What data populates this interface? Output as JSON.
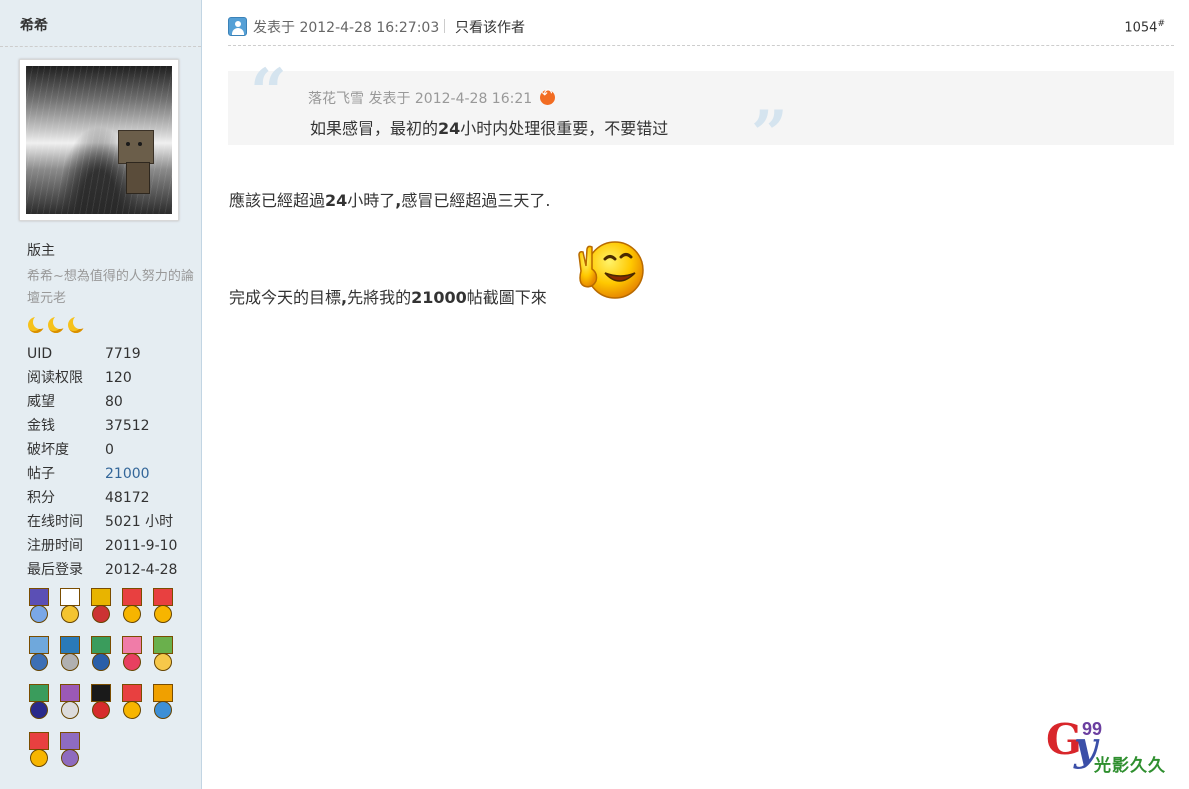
{
  "author": {
    "name": "希希",
    "rank": "版主",
    "title": "希希~想為值得的人努力的論壇元老",
    "star_icons": [
      "moon-icon",
      "moon-icon",
      "moon-icon"
    ]
  },
  "stats": [
    {
      "label": "UID",
      "value": "7719"
    },
    {
      "label": "阅读权限",
      "value": "120"
    },
    {
      "label": "威望",
      "value": "80"
    },
    {
      "label": "金钱",
      "value": "37512"
    },
    {
      "label": "破坏度",
      "value": "0"
    },
    {
      "label": "帖子",
      "value": "21000",
      "link": true
    },
    {
      "label": "积分",
      "value": "48172"
    },
    {
      "label": "在线时间",
      "value": "5021 小时"
    },
    {
      "label": "注册时间",
      "value": "2011-9-10"
    },
    {
      "label": "最后登录",
      "value": "2012-4-28"
    }
  ],
  "medals": [
    [
      {
        "icon": "medal-3-icon",
        "ribbon": "#5b4fb5",
        "disc": "#7aa7e6"
      },
      {
        "icon": "magic-wand-medal-icon",
        "ribbon": "#ffffff",
        "disc": "#f4c430"
      },
      {
        "icon": "medal-icon",
        "ribbon": "#e8b400",
        "disc": "#c33"
      },
      {
        "icon": "diligence-medal-icon",
        "ribbon": "#e84040",
        "disc": "#f7b500"
      },
      {
        "icon": "sun-medal-icon",
        "ribbon": "#e84040",
        "disc": "#f7b500"
      }
    ],
    [
      {
        "icon": "blue-medal-icon",
        "ribbon": "#6fa8dc",
        "disc": "#3d6fb5"
      },
      {
        "icon": "eye-medal-icon",
        "ribbon": "#2a7ab8",
        "disc": "#b0b0b0"
      },
      {
        "icon": "god-medal-icon",
        "ribbon": "#3a9c5c",
        "disc": "#2a5fa8"
      },
      {
        "icon": "pink-medal-icon",
        "ribbon": "#f07ca8",
        "disc": "#e84060"
      },
      {
        "icon": "flower-medal-icon",
        "ribbon": "#6ab04c",
        "disc": "#f7c84a"
      }
    ],
    [
      {
        "icon": "star-medal-icon",
        "ribbon": "#3a9c5c",
        "disc": "#2a2a8a"
      },
      {
        "icon": "purple-medal-icon",
        "ribbon": "#9b59b6",
        "disc": "#dcdcdc"
      },
      {
        "icon": "ball-medal-icon",
        "ribbon": "#1a1a1a",
        "disc": "#d62c2c"
      },
      {
        "icon": "gold-medal-icon",
        "ribbon": "#e84040",
        "disc": "#f7b500"
      },
      {
        "icon": "blue-disc-medal-icon",
        "ribbon": "#f0a000",
        "disc": "#3d8fd6"
      }
    ],
    [
      {
        "icon": "sun-medal-icon",
        "ribbon": "#e84040",
        "disc": "#f7b500"
      },
      {
        "icon": "gear-medal-icon",
        "ribbon": "#8e6bbf",
        "disc": "#8e6bbf"
      }
    ]
  ],
  "post": {
    "posted_at": "发表于 2012-4-28 16:27:03",
    "only_author": "只看该作者",
    "floor": "1054",
    "floor_mark": "#",
    "quote": {
      "author": "落花飞雪",
      "posted_at": "发表于 2012-4-28 16:21",
      "text_before": "如果感冒，最初的",
      "text_bold": "24",
      "text_after": "小时内处理很重要，不要错过"
    },
    "line1_a": "應該已經超過",
    "line1_b": "24",
    "line1_c": "小時了",
    "line1_d": ",",
    "line1_e": "感冒已經超過三天了.",
    "line2_a": "完成今天的目標",
    "line2_b": ",",
    "line2_c": "先將我的",
    "line2_d": "21000",
    "line2_e": "帖截圖下來",
    "emoticon": "victory-smiley-icon"
  },
  "watermark": {
    "g": "G",
    "y": "y",
    "num": "99",
    "text": "光影久久"
  },
  "colors": {
    "sidebar_bg": "#e5edf2",
    "link": "#336699",
    "quote_bg": "#f5f5f5"
  }
}
